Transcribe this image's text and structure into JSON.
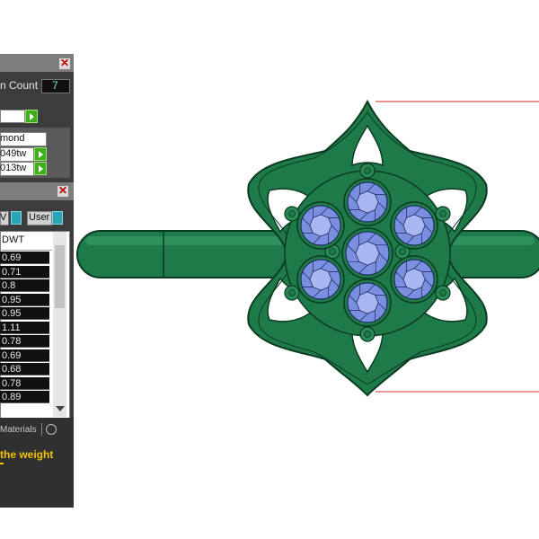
{
  "panel1": {
    "count_label": "n Count",
    "count_value": "7",
    "shape_label": "mond",
    "weight_row1": "049tw",
    "weight_row2": "013tw"
  },
  "panel2": {
    "dropdown_left": "V",
    "dropdown_user": "User",
    "column_header": "DWT",
    "rows": [
      "0.69",
      "0.71",
      "0.8",
      "0.95",
      "0.95",
      "1.11",
      "0.78",
      "0.69",
      "0.68",
      "0.78",
      "0.89"
    ],
    "tab_materials": "Materials",
    "hint_text": " the weight"
  },
  "colors": {
    "panel_bg": "#3c3c3c",
    "titlebar": "#7d7d7d",
    "model_green": "#1f7a4a",
    "gem_blue": "#7b8fe0",
    "accent_yellow": "#f2c200",
    "dimension_red": "#d22a2a"
  },
  "icons": [
    "close-icon",
    "play-arrow-icon",
    "dropdown-icon",
    "scroll-down-icon"
  ]
}
